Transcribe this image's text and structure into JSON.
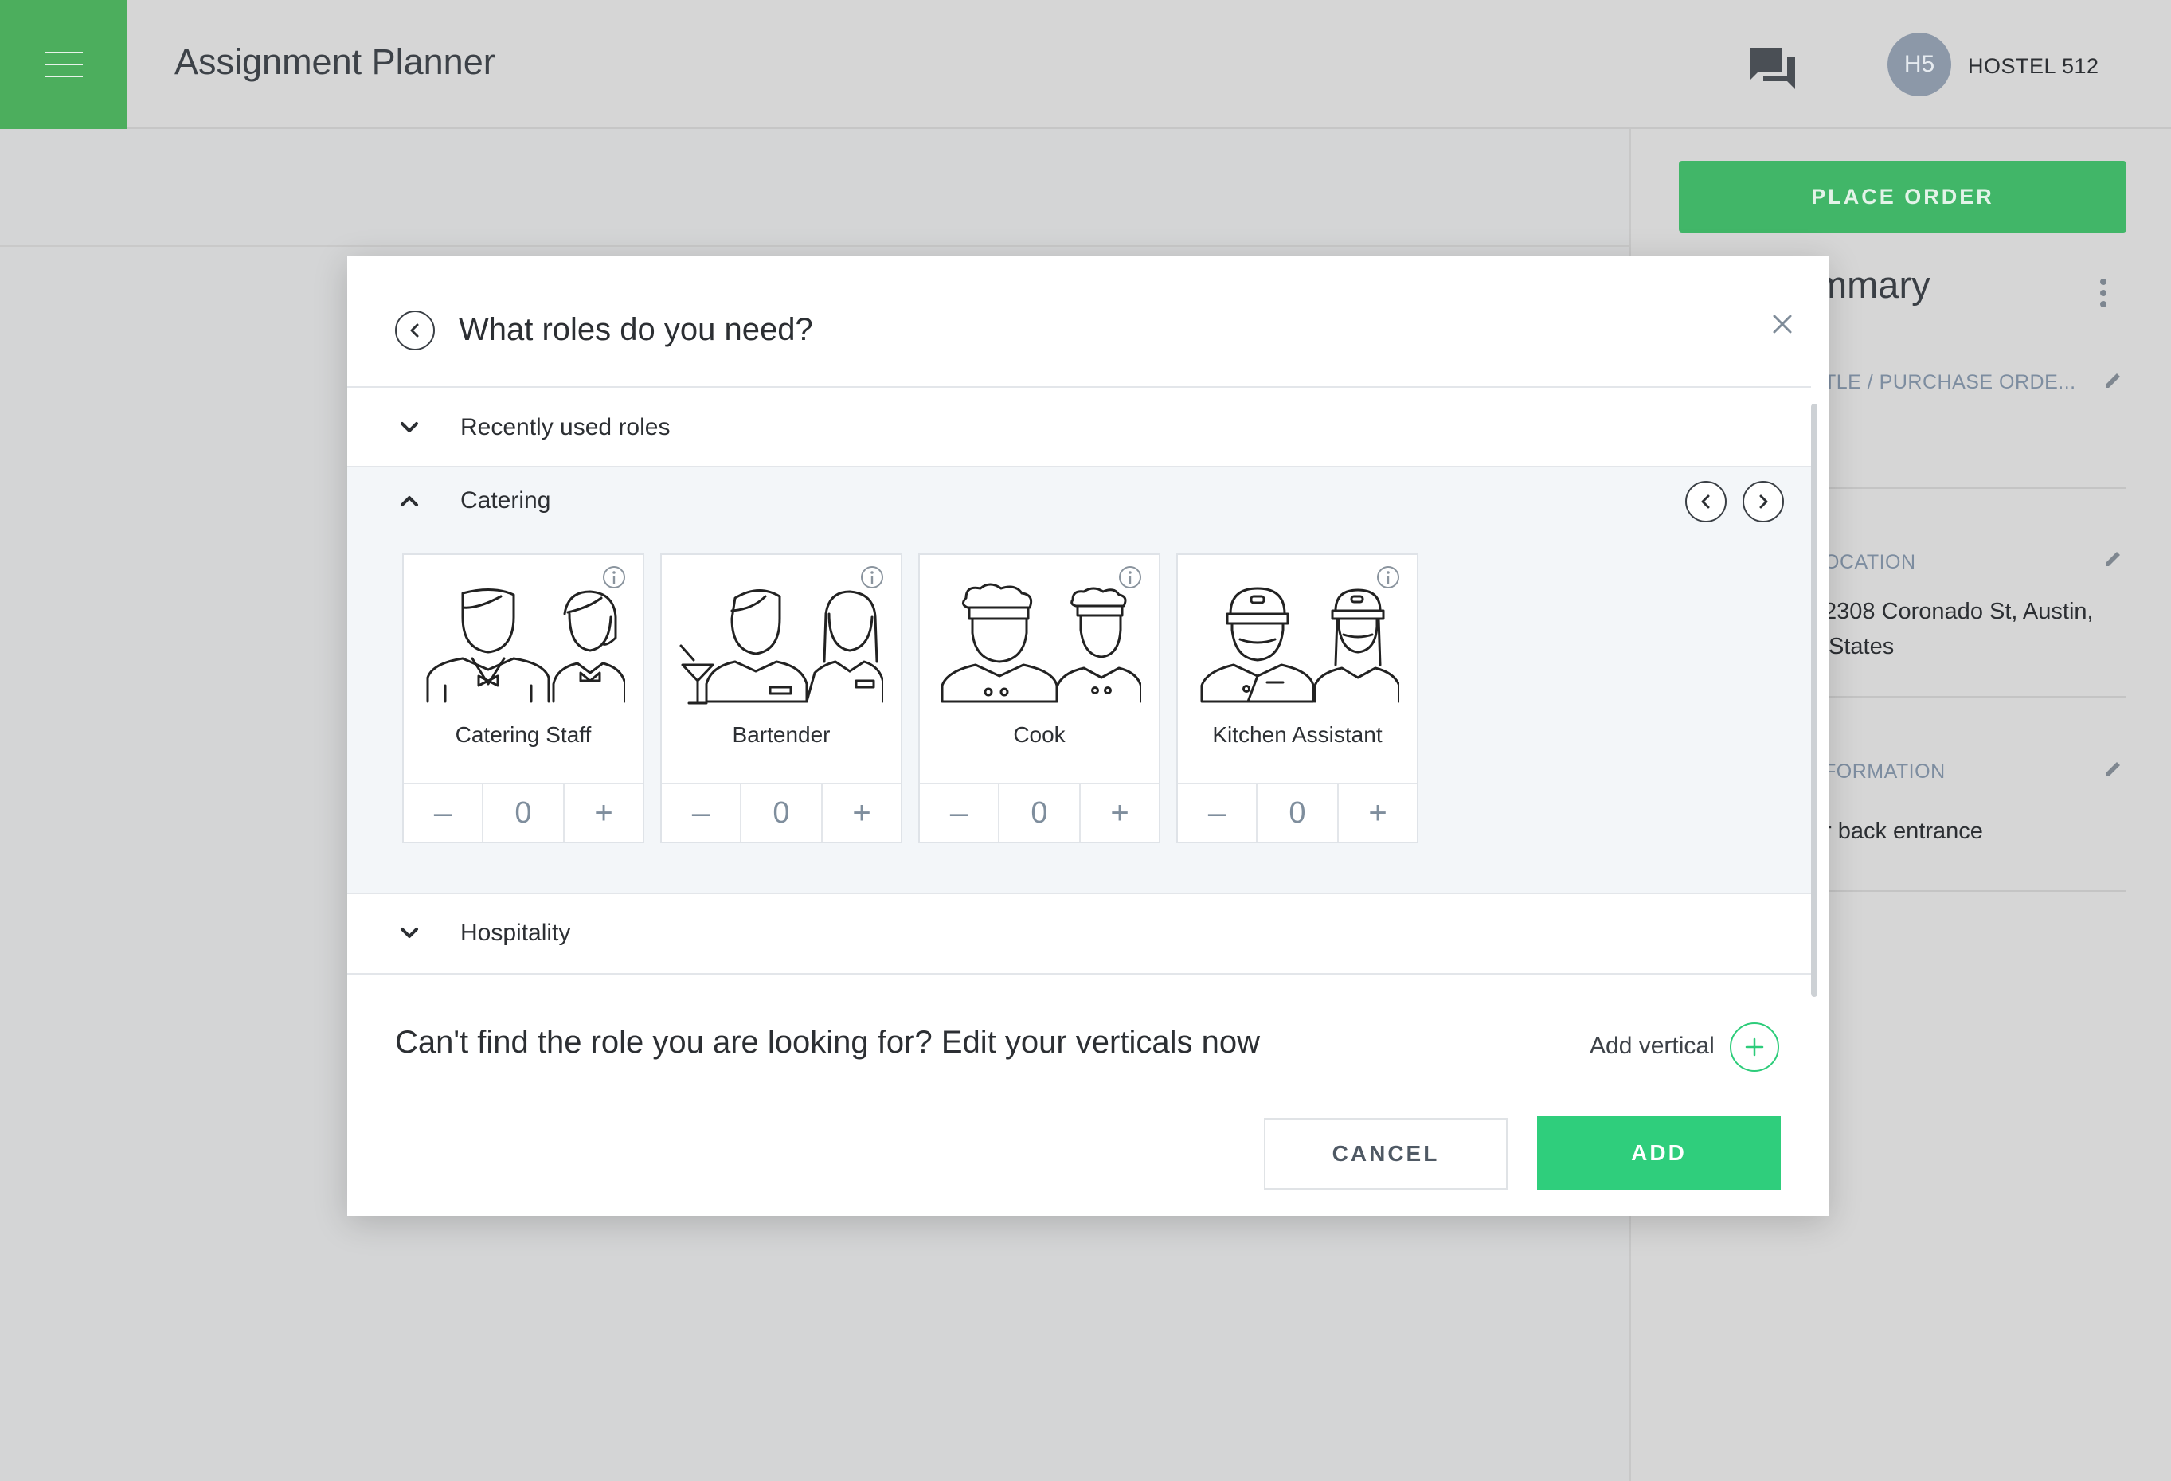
{
  "header": {
    "app_title": "Assignment Planner",
    "menu_icon": "hamburger-icon",
    "chat_icon": "chat-icon",
    "avatar_initials": "H5",
    "account_name": "HOSTEL 512"
  },
  "right_panel": {
    "place_order_label": "PLACE ORDER",
    "heading": "mmary",
    "field1_label": "TLE / PURCHASE ORDE...",
    "field2_label": "OCATION",
    "field2_line1": "2308 Coronado St, Austin,",
    "field2_line2": "States",
    "field3_label": "FORMATION",
    "field3_value": "r back entrance"
  },
  "modal": {
    "title": "What roles do you need?",
    "sections": {
      "recent": "Recently used roles",
      "catering": "Catering",
      "hospitality": "Hospitality"
    },
    "roles": [
      {
        "name": "Catering Staff",
        "count": "0",
        "icon": "catering-staff-icon"
      },
      {
        "name": "Bartender",
        "count": "0",
        "icon": "bartender-icon"
      },
      {
        "name": "Cook",
        "count": "0",
        "icon": "cook-icon"
      },
      {
        "name": "Kitchen Assistant",
        "count": "0",
        "icon": "kitchen-assistant-icon"
      }
    ],
    "stepper_minus": "–",
    "stepper_plus": "+",
    "cant_find_text": "Can't find the role you are looking for? Edit your verticals now",
    "add_vertical_label": "Add vertical",
    "cancel_label": "CANCEL",
    "add_label": "ADD"
  },
  "colors": {
    "brand_green": "#4cae5d",
    "accent_green": "#2fce7c",
    "place_order_green": "#41b668"
  }
}
